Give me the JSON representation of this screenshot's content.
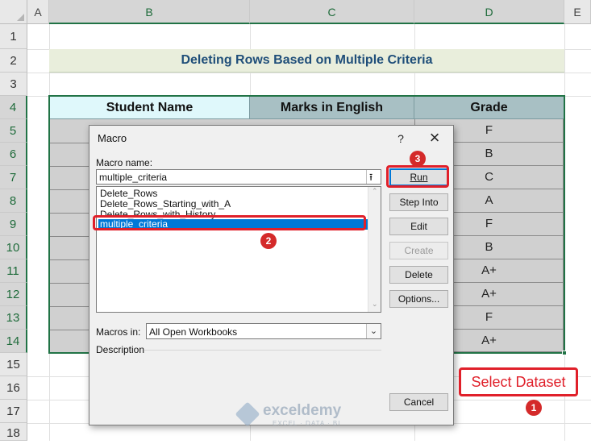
{
  "spreadsheet": {
    "columns": [
      "A",
      "B",
      "C",
      "D",
      "E"
    ],
    "rows": [
      "1",
      "2",
      "3",
      "4",
      "5",
      "6",
      "7",
      "8",
      "9",
      "10",
      "11",
      "12",
      "13",
      "14",
      "15",
      "16",
      "17",
      "18"
    ],
    "title": "Deleting Rows Based on Multiple Criteria",
    "headers": [
      "Student Name",
      "Marks in English",
      "Grade"
    ],
    "grades": [
      "F",
      "B",
      "C",
      "A",
      "F",
      "B",
      "A+",
      "A+",
      "F",
      "A+"
    ]
  },
  "dialog": {
    "title": "Macro",
    "help_label": "?",
    "close_label": "×",
    "macro_name_label": "Macro name:",
    "macro_name_value": "multiple_criteria",
    "macro_list": [
      "Delete_Rows",
      "Delete_Rows_Starting_with_A",
      "Delete_Rows_with_History",
      "multiple_criteria"
    ],
    "selected_macro": "multiple_criteria",
    "buttons": {
      "run": "Run",
      "step_into": "Step Into",
      "edit": "Edit",
      "create": "Create",
      "delete": "Delete",
      "options": "Options...",
      "cancel": "Cancel"
    },
    "macros_in_label": "Macros in:",
    "macros_in_value": "All Open Workbooks",
    "description_label": "Description"
  },
  "annotations": {
    "select_dataset": "Select Dataset",
    "badge_1": "1",
    "badge_2": "2",
    "badge_3": "3"
  },
  "watermark": {
    "brand": "exceldemy",
    "tagline": "EXCEL · DATA · BI"
  },
  "colors": {
    "title_bg": "#e9eedc",
    "title_text": "#1f4e79",
    "header_name_bg": "#dff8fb",
    "header_bg": "#a8c0c4",
    "grade_bg": "#d0d0d0",
    "selection_border": "#217346",
    "selected_item_bg": "#0078d7",
    "annotation_red": "#e0202a"
  }
}
